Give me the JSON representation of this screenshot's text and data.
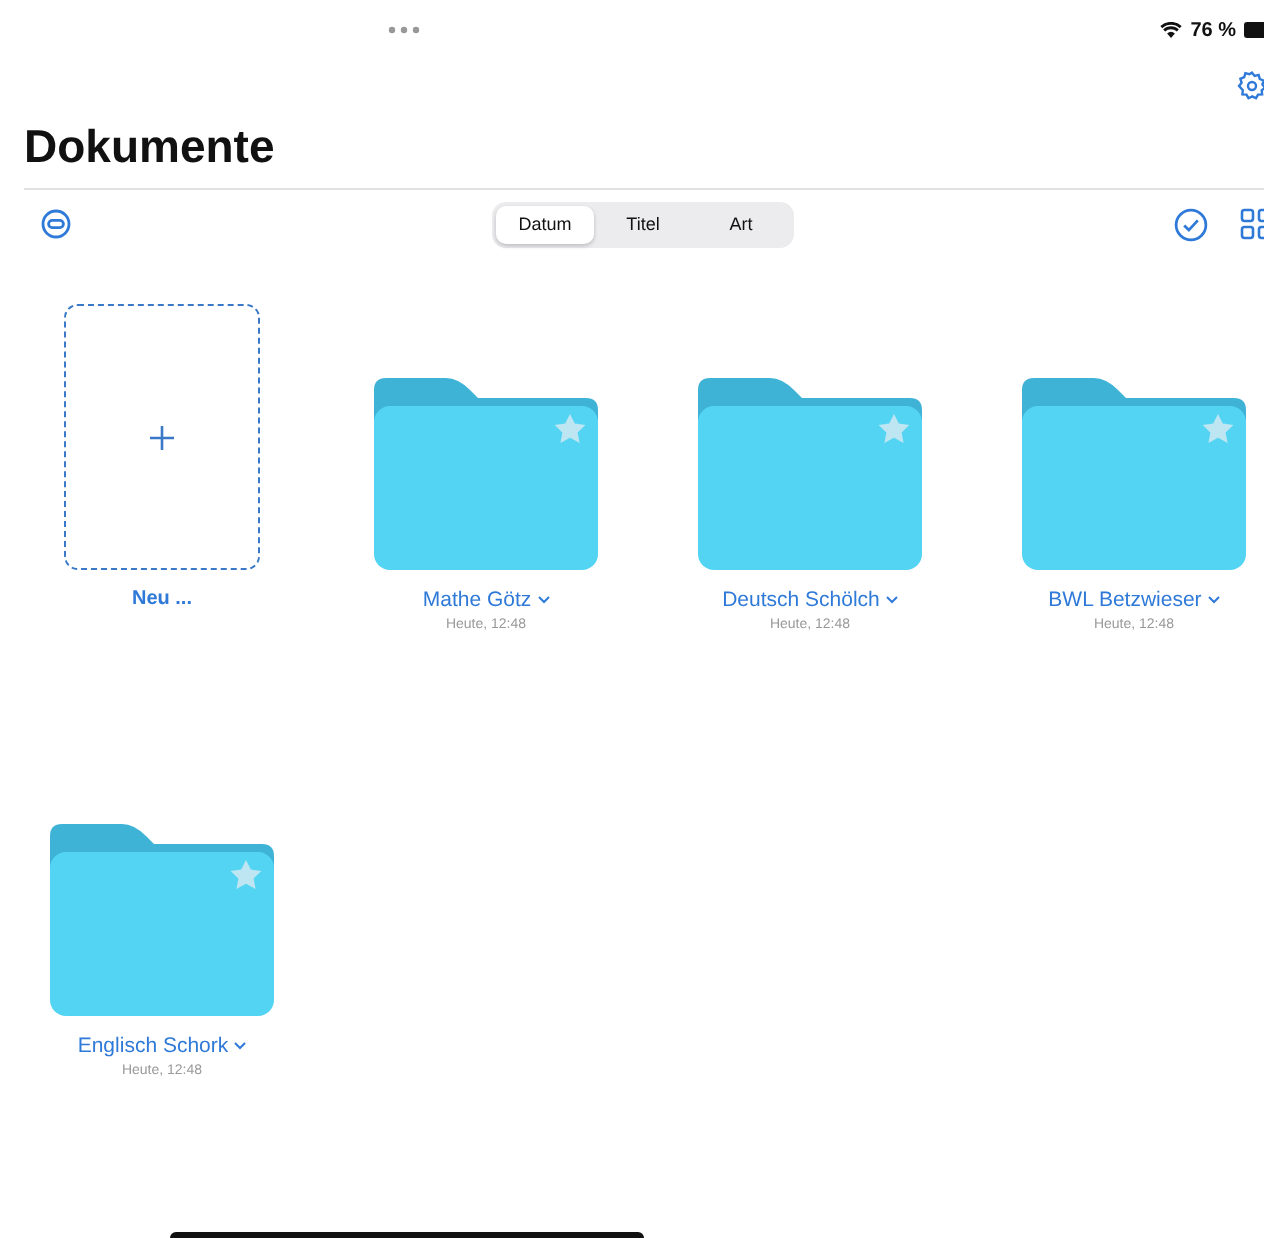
{
  "status_bar": {
    "battery": "76 %"
  },
  "title": "Dokumente",
  "sort_tabs": [
    {
      "label": "Datum",
      "selected": true
    },
    {
      "label": "Titel",
      "selected": false
    },
    {
      "label": "Art",
      "selected": false
    }
  ],
  "new_item": {
    "label": "Neu ..."
  },
  "folders": [
    {
      "name": "Mathe Götz",
      "date": "Heute, 12:48",
      "starred": true
    },
    {
      "name": "Deutsch Schölch",
      "date": "Heute, 12:48",
      "starred": true
    },
    {
      "name": "BWL Betzwieser",
      "date": "Heute, 12:48",
      "starred": true
    },
    {
      "name": "Englisch Schork",
      "date": "Heute, 12:48",
      "starred": true
    }
  ]
}
